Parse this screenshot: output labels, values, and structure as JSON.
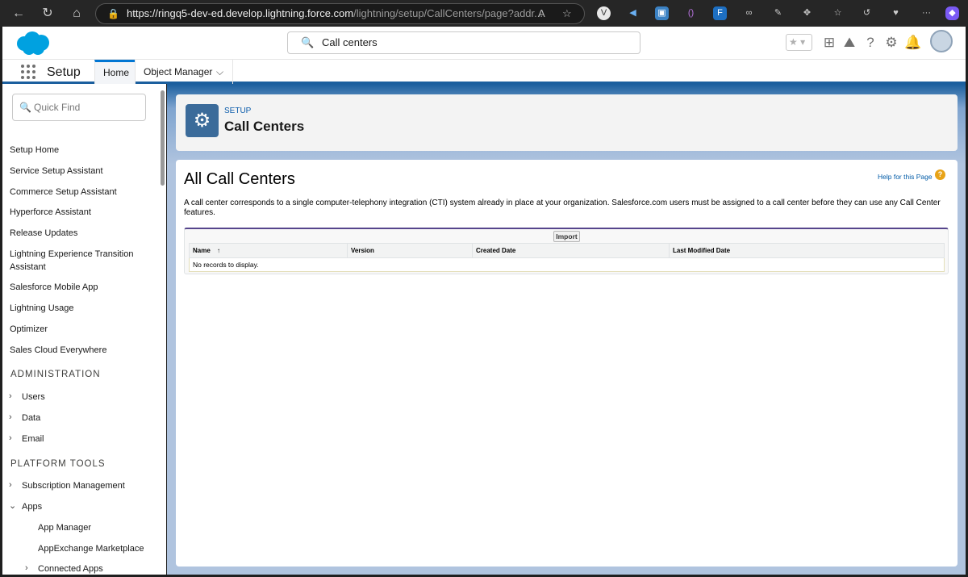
{
  "browser": {
    "url_host": "https://ringq5-dev-ed.develop.lightning.force.com",
    "url_path": "/lightning/setup/CallCenters/page?addr..."
  },
  "header": {
    "search_value": "Call centers"
  },
  "nav": {
    "app_name": "Setup",
    "tabs": [
      {
        "label": "Home",
        "active": true
      },
      {
        "label": "Object Manager",
        "active": false
      }
    ]
  },
  "sidebar": {
    "quick_find_placeholder": "Quick Find",
    "items": [
      "Setup Home",
      "Service Setup Assistant",
      "Commerce Setup Assistant",
      "Hyperforce Assistant",
      "Release Updates",
      "Lightning Experience Transition Assistant",
      "Salesforce Mobile App",
      "Lightning Usage",
      "Optimizer",
      "Sales Cloud Everywhere"
    ],
    "administration_heading": "ADMINISTRATION",
    "administration_items": [
      "Users",
      "Data",
      "Email"
    ],
    "platform_heading": "PLATFORM TOOLS",
    "platform_items": [
      "Subscription Management",
      "Apps"
    ],
    "apps_children": [
      "App Manager",
      "AppExchange Marketplace",
      "Connected Apps"
    ]
  },
  "page": {
    "breadcrumb": "SETUP",
    "title": "Call Centers",
    "heading": "All Call Centers",
    "help_link": "Help for this Page",
    "help_icon_glyph": "?",
    "description": "A call center corresponds to a single computer-telephony integration (CTI) system already in place at your organization. Salesforce.com users must be assigned to a call center before they can use any Call Center features.",
    "import_label": "Import",
    "columns": [
      "Name",
      "Version",
      "Created Date",
      "Last Modified Date"
    ],
    "name_sort_indicator": "↑",
    "empty_message": "No records to display."
  },
  "colors": {
    "brand_blue": "#0176d3",
    "nav_border": "#1b5f9e",
    "list_accent": "#56458c"
  }
}
